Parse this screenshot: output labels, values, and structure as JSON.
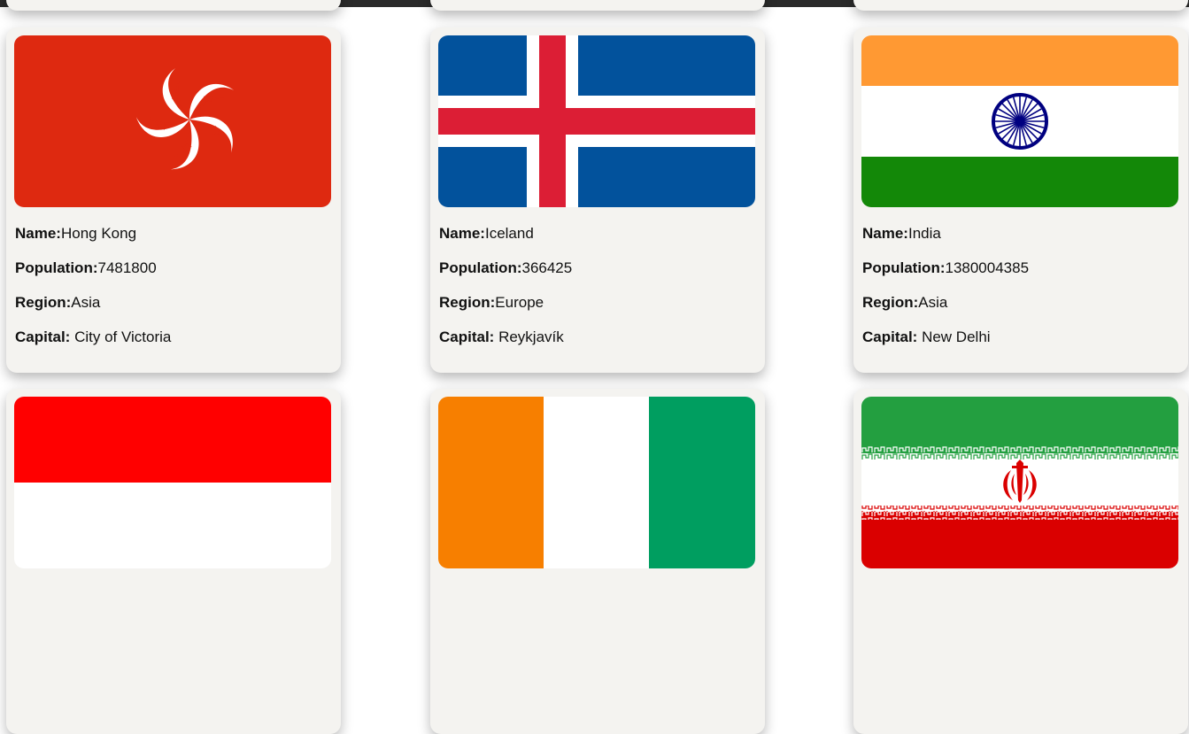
{
  "labels": {
    "name": "Name:",
    "population": "Population:",
    "region": "Region:",
    "capital": "Capital:"
  },
  "countries": [
    {
      "name": "Hong Kong",
      "population": "7481800",
      "region": "Asia",
      "capital": "City of Victoria",
      "flag_icon": "hong-kong-flag"
    },
    {
      "name": "Iceland",
      "population": "366425",
      "region": "Europe",
      "capital": "Reykjavík",
      "flag_icon": "iceland-flag"
    },
    {
      "name": "India",
      "population": "1380004385",
      "region": "Asia",
      "capital": "New Delhi",
      "flag_icon": "india-flag"
    },
    {
      "flag_icon": "indonesia-flag"
    },
    {
      "flag_icon": "ivory-coast-flag"
    },
    {
      "flag_icon": "iran-flag"
    }
  ],
  "colors": {
    "card_background": "#f4f3f0",
    "hong_kong_red": "#de2910",
    "iceland_blue": "#02529c",
    "iceland_red": "#dc1e35",
    "india_saffron": "#ff9933",
    "india_green": "#138808",
    "india_chakra": "#000080",
    "indonesia_red": "#ff0000",
    "ivory_coast_orange": "#f77f00",
    "ivory_coast_green": "#009e60",
    "iran_green": "#239f40",
    "iran_red": "#da0000"
  }
}
